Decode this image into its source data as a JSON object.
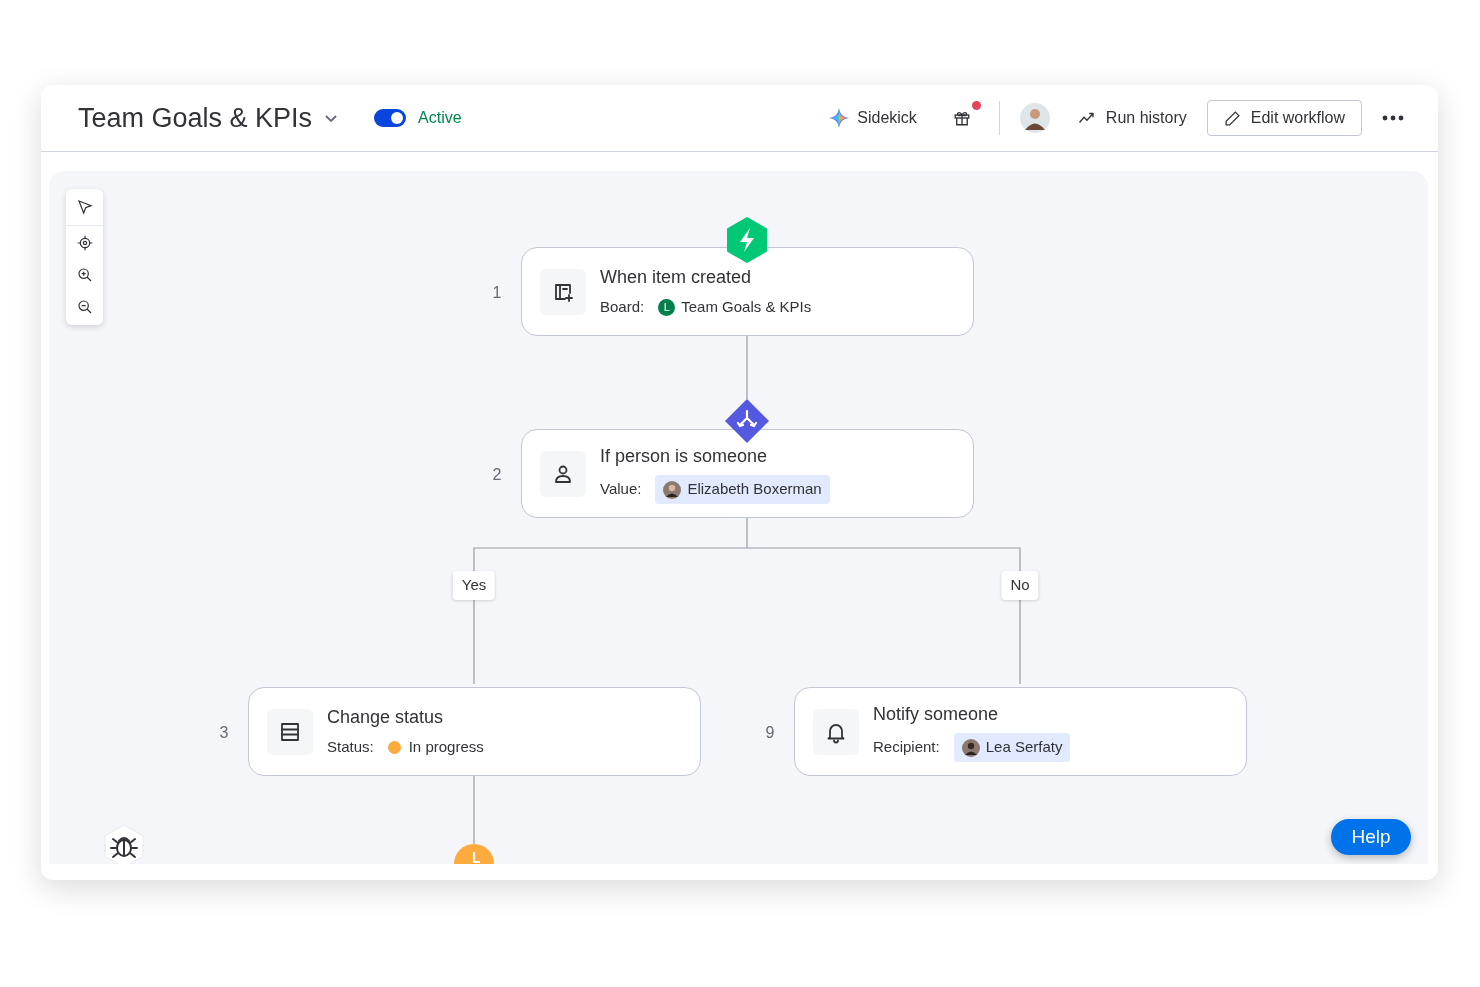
{
  "header": {
    "title": "Team Goals & KPIs",
    "toggle": {
      "label": "Active",
      "on": true
    },
    "sidekick": "Sidekick",
    "gift_notification": true,
    "run_history": "Run history",
    "edit": "Edit workflow"
  },
  "nodes": [
    {
      "step": "1",
      "kind": "trigger",
      "title": "When item created",
      "field_label": "Board:",
      "value": {
        "kind": "board",
        "badge": "L",
        "text": "Team Goals & KPIs"
      }
    },
    {
      "step": "2",
      "kind": "condition",
      "title": "If person is someone",
      "field_label": "Value:",
      "value": {
        "kind": "person",
        "text": "Elizabeth Boxerman"
      }
    },
    {
      "step": "3",
      "kind": "status",
      "title": "Change status",
      "field_label": "Status:",
      "value": {
        "kind": "status",
        "color": "#fdab3d",
        "text": "In progress"
      }
    },
    {
      "step": "9",
      "kind": "notify",
      "title": "Notify someone",
      "field_label": "Recipient:",
      "value": {
        "kind": "person",
        "text": "Lea Serfaty"
      }
    }
  ],
  "branches": [
    {
      "label": "Yes"
    },
    {
      "label": "No"
    }
  ],
  "help": "Help"
}
